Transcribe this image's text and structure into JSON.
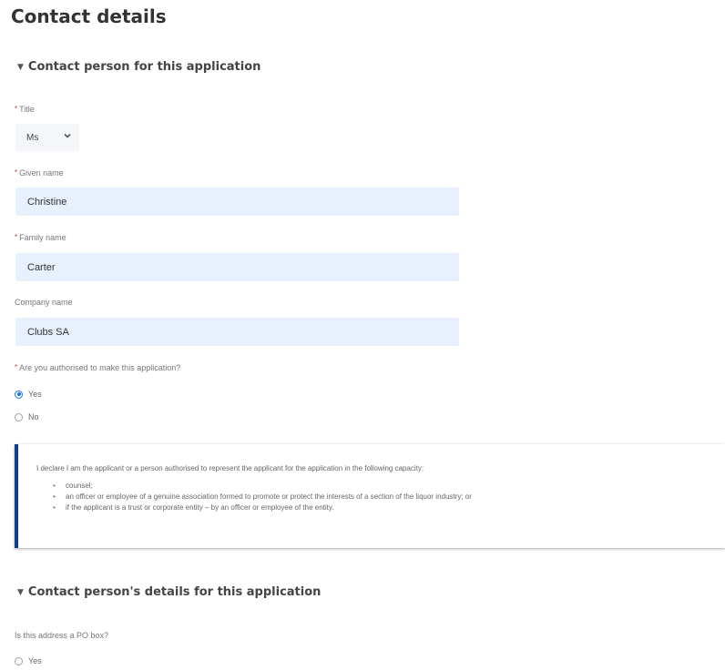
{
  "page_title": "Contact details",
  "section1": {
    "header": "Contact person for this application",
    "title_field": {
      "label": "Title",
      "required_mark": "*",
      "value": "Ms"
    },
    "given_name": {
      "label": "Given name",
      "required_mark": "*",
      "value": "Christine"
    },
    "family_name": {
      "label": "Family name",
      "required_mark": "*",
      "value": "Carter"
    },
    "company_name": {
      "label": "Company name",
      "value": "Clubs SA"
    },
    "authorised": {
      "question": "Are you authorised to make this application?",
      "required_mark": "*",
      "options": [
        {
          "label": "Yes",
          "selected": true
        },
        {
          "label": "No",
          "selected": false
        }
      ]
    },
    "declaration": {
      "intro": "I declare I am the applicant or a person authorised to represent the applicant for the application in the following capacity:",
      "items": [
        "counsel;",
        "an officer or employee of a genuine association formed to promote or protect the interests of a section of the liquor industry; or",
        "if the applicant is a trust or corporate entity – by an officer or employee of the entity."
      ],
      "accent_color": "#0b3d91"
    }
  },
  "section2": {
    "header": "Contact person's details for this application",
    "po_box": {
      "question": "Is this address a PO box?",
      "options": [
        {
          "label": "Yes",
          "selected": false
        }
      ]
    }
  },
  "colors": {
    "input_background": "#e8f0fe",
    "radio_selected": "#1a73e8",
    "required_mark": "#c0392b"
  }
}
